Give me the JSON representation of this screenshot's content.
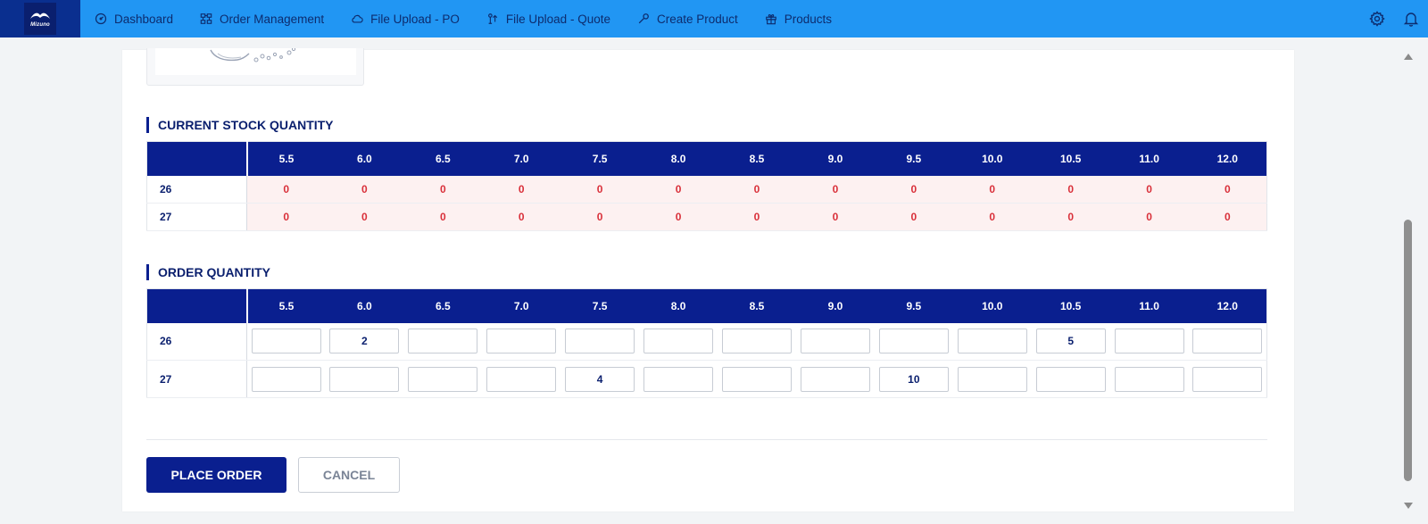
{
  "brand": {
    "logo_text": "Mizuno"
  },
  "nav": {
    "items": [
      {
        "label": "Dashboard",
        "icon": "dashboard-gauge-icon"
      },
      {
        "label": "Order Management",
        "icon": "order-management-icon"
      },
      {
        "label": "File Upload - PO",
        "icon": "cloud-icon"
      },
      {
        "label": "File Upload - Quote",
        "icon": "file-upload-icon"
      },
      {
        "label": "Create Product",
        "icon": "wrench-icon"
      },
      {
        "label": "Products",
        "icon": "gift-icon"
      }
    ],
    "right_icons": [
      "settings-gear-icon",
      "notification-bell-icon"
    ]
  },
  "sizes": [
    "5.5",
    "6.0",
    "6.5",
    "7.0",
    "7.5",
    "8.0",
    "8.5",
    "9.0",
    "9.5",
    "10.0",
    "10.5",
    "11.0",
    "12.0"
  ],
  "stock": {
    "title": "CURRENT STOCK QUANTITY",
    "rows": [
      {
        "label": "26",
        "values": [
          "0",
          "0",
          "0",
          "0",
          "0",
          "0",
          "0",
          "0",
          "0",
          "0",
          "0",
          "0",
          "0"
        ]
      },
      {
        "label": "27",
        "values": [
          "0",
          "0",
          "0",
          "0",
          "0",
          "0",
          "0",
          "0",
          "0",
          "0",
          "0",
          "0",
          "0"
        ]
      }
    ]
  },
  "order": {
    "title": "ORDER QUANTITY",
    "rows": [
      {
        "label": "26",
        "values": [
          "",
          "2",
          "",
          "",
          "",
          "",
          "",
          "",
          "",
          "",
          "5",
          "",
          ""
        ]
      },
      {
        "label": "27",
        "values": [
          "",
          "",
          "",
          "",
          "4",
          "",
          "",
          "",
          "10",
          "",
          "",
          "",
          ""
        ]
      }
    ]
  },
  "actions": {
    "place_order": "PLACE ORDER",
    "cancel": "CANCEL"
  },
  "colors": {
    "nav_bg": "#2196f3",
    "primary": "#0a1f8f",
    "stock_text": "#d9303a",
    "stock_bg": "#fdf1f1"
  }
}
